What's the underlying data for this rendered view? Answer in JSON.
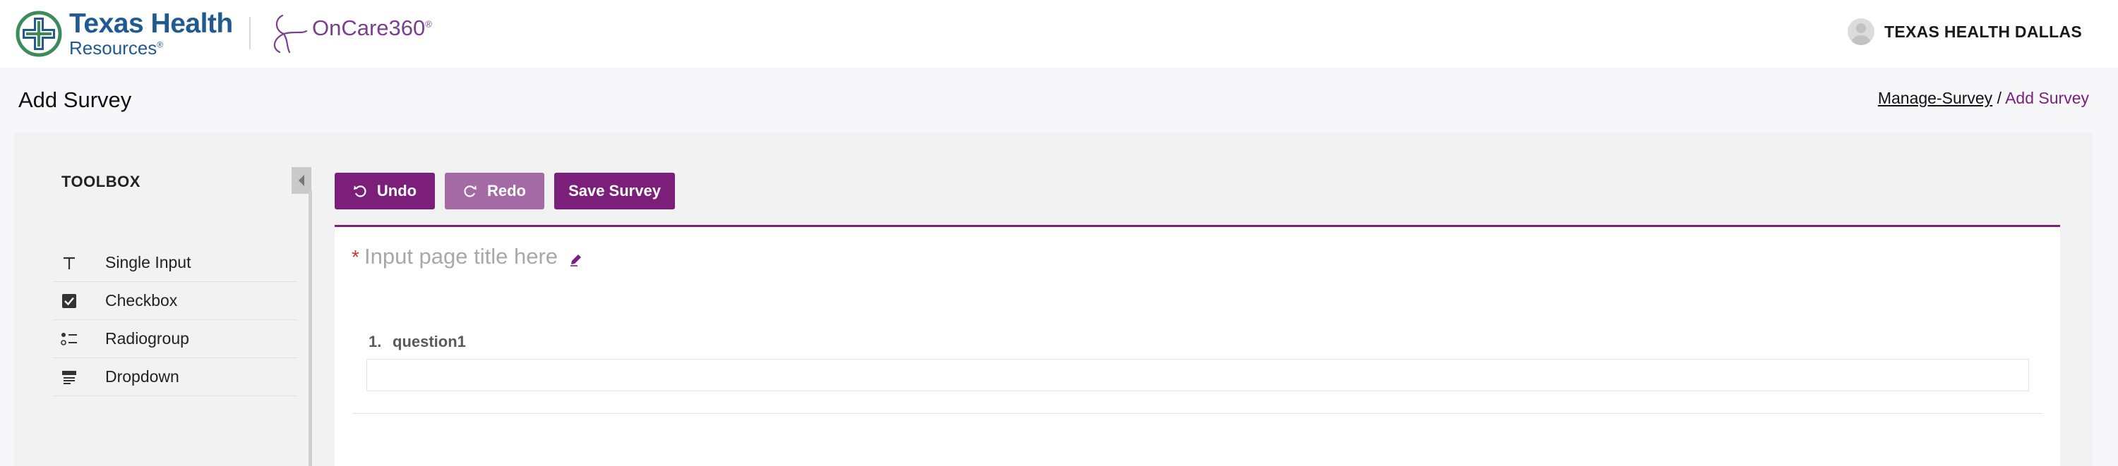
{
  "header": {
    "brand_name": "Texas Health",
    "brand_sub": "Resources",
    "brand_sub_mark": "®",
    "partner_name": "OnCare360",
    "partner_mark": "®",
    "user_name": "TEXAS HEALTH DALLAS"
  },
  "page": {
    "title": "Add Survey",
    "breadcrumb": {
      "parent": "Manage-Survey",
      "separator": "/",
      "current": "Add Survey"
    }
  },
  "toolbox": {
    "title": "TOOLBOX",
    "items": [
      {
        "label": "Single Input",
        "icon": "text-icon"
      },
      {
        "label": "Checkbox",
        "icon": "checkbox-icon"
      },
      {
        "label": "Radiogroup",
        "icon": "radiogroup-icon"
      },
      {
        "label": "Dropdown",
        "icon": "dropdown-icon"
      }
    ]
  },
  "toolbar": {
    "undo_label": "Undo",
    "redo_label": "Redo",
    "save_label": "Save Survey"
  },
  "survey": {
    "required_mark": "*",
    "page_title_placeholder": "Input page title here",
    "questions": [
      {
        "number": "1.",
        "title": "question1",
        "value": ""
      }
    ]
  },
  "colors": {
    "accent": "#7b1f7a",
    "accent_disabled": "#a46aa5",
    "brand_blue": "#1f5a93",
    "partner_purple": "#7b3f8c"
  }
}
